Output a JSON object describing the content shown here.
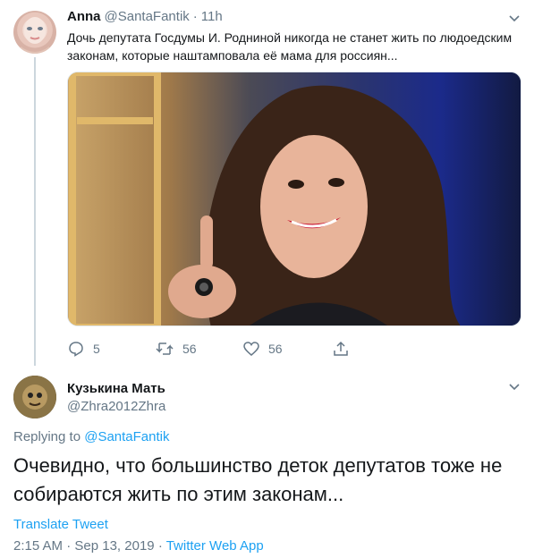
{
  "tweet": {
    "author_name": "Anna",
    "author_handle": "@SantaFantik",
    "separator": "·",
    "time": "11h",
    "text": "Дочь депутата Госдумы И. Родниной никогда не станет жить по людоедским законам, которые наштамповала её мама для россиян...",
    "actions": {
      "reply_count": "5",
      "retweet_count": "56",
      "like_count": "56"
    }
  },
  "reply": {
    "author_name": "Кузькина Мать",
    "author_handle": "@Zhra2012Zhra",
    "replying_prefix": "Replying to ",
    "replying_handle": "@SantaFantik",
    "text": "Очевидно, что большинство деток депутатов тоже не собираются жить по этим законам...",
    "translate_label": "Translate Tweet",
    "time": "2:15 AM",
    "separator": "·",
    "date": "Sep 13, 2019",
    "separator2": "·",
    "source": "Twitter Web App"
  },
  "icons": {
    "reply": "reply-icon",
    "retweet": "retweet-icon",
    "like": "heart-icon",
    "share": "share-icon",
    "more": "chevron-down-icon"
  },
  "colors": {
    "link": "#1da1f2",
    "muted": "#657786",
    "text": "#14171a"
  }
}
